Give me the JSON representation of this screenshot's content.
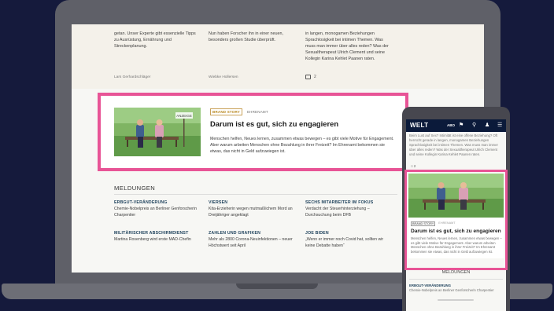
{
  "laptop": {
    "top_columns": [
      "getan. Unser Experte gibt essenzielle Tipps zu Ausrüstung, Ernährung und Streckenplanung.",
      "Nun haben Forscher ihn in einer neuen, besonders großen Studie überprüft.",
      "in langen, monogamen Beziehungen Sprachlosigkeit bei intimen Themen. Was muss man immer über alles reden? Was der Sexualtherapeut Ulrich Clement und seine Kollegin Karina Kehlet Paanen raten."
    ],
    "authors": [
      "Lars Gerhardschläger",
      "Wiebke Hollersen"
    ],
    "comment_count": "2",
    "brand_story": {
      "badge": "BRAND STORY",
      "category": "EHRENAMT",
      "photo_sign": "ANZEIGE",
      "title": "Darum ist es gut, sich zu engagieren",
      "body": "Menschen helfen, Neues lernen, zusammen etwas bewegen – es gibt viele Motive für Engagement. Aber warum arbeiten Menschen ohne Bezahlung in ihrer Freizeit? Im Ehrenamt bekommen sie etwas, das nicht in Geld aufzuwiegen ist."
    },
    "meldungen": {
      "heading": "MELDUNGEN",
      "items": [
        {
          "title": "ERBGUT-VERÄNDERUNG",
          "text": "Chemie-Nobelpreis an Berliner Genforscherin Charpentier"
        },
        {
          "title": "VIERSEN",
          "text": "Kita-Erzieherin wegen mutmaßlichem Mord an Dreijähriger angeklagt"
        },
        {
          "title": "SECHS MITARBEITER IM FOKUS",
          "text": "Verdacht der Steuerhinterziehung – Durchsuchung beim DFB"
        },
        {
          "title": "MILITÄRISCHER ABSCHIRMDIENST",
          "text": "Martina Rosenberg wird erste MAD-Chefin"
        },
        {
          "title": "ZAHLEN UND GRAFIKEN",
          "text": "Mehr als 2800 Corona-Neuinfektionen – neuer Höchstwert seit April"
        },
        {
          "title": "JOE BIDEN",
          "text": "„Wenn er immer noch Covid hat, sollten wir keine Debatte haben“"
        }
      ]
    }
  },
  "phone": {
    "logo": "WELT",
    "abo": "ABO",
    "top_text": "Beim Lust auf Sex? Intimität ist eine offene Beziehung? Oft herrscht gerade in langen, monogamen Beziehungen Sprachlosigkeit bei intimen Themen. Was muss man immer über alles reden? Was der Sexualtherapeut Ulrich Clement und seine Kollegin Karina Kehlet Paanen raten.",
    "comment_count": "2",
    "badge": "BRAND STORY",
    "category": "EHRENAMT",
    "title": "Darum ist es gut, sich zu engagieren",
    "body": "Menschen helfen, Neues lernen, zusammen etwas bewegen – es gibt viele Motive für Engagement. Aber warum arbeiten Menschen ohne Bezahlung in ihrer Freizeit? Im Ehrenamt bekommen sie etwas, das nicht in Geld aufzuwiegen ist.",
    "meldungen_heading": "MELDUNGEN",
    "mel_title": "ERBGUT-VERÄNDERUNG",
    "mel_text": "Chemie-Nobelpreis an Berliner Genforscherin Charpentier"
  },
  "colors": {
    "background": "#151a3c",
    "highlight": "#e85496",
    "headline_blue": "#21445e",
    "badge_gold": "#b8861c",
    "phone_header": "#0b1a3a"
  }
}
